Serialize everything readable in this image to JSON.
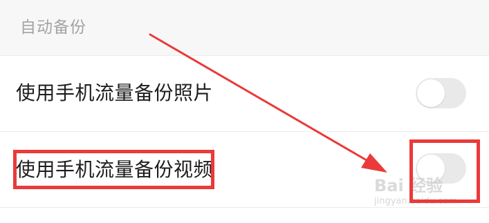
{
  "section": {
    "title": "自动备份"
  },
  "settings": [
    {
      "label": "使用手机流量备份照片",
      "enabled": false
    },
    {
      "label": "使用手机流量备份视频",
      "enabled": false
    }
  ],
  "annotation": {
    "color": "#ea3a3a"
  },
  "watermark": {
    "text": "Bai 经验",
    "subtext": "jingyan.baidu.com"
  }
}
